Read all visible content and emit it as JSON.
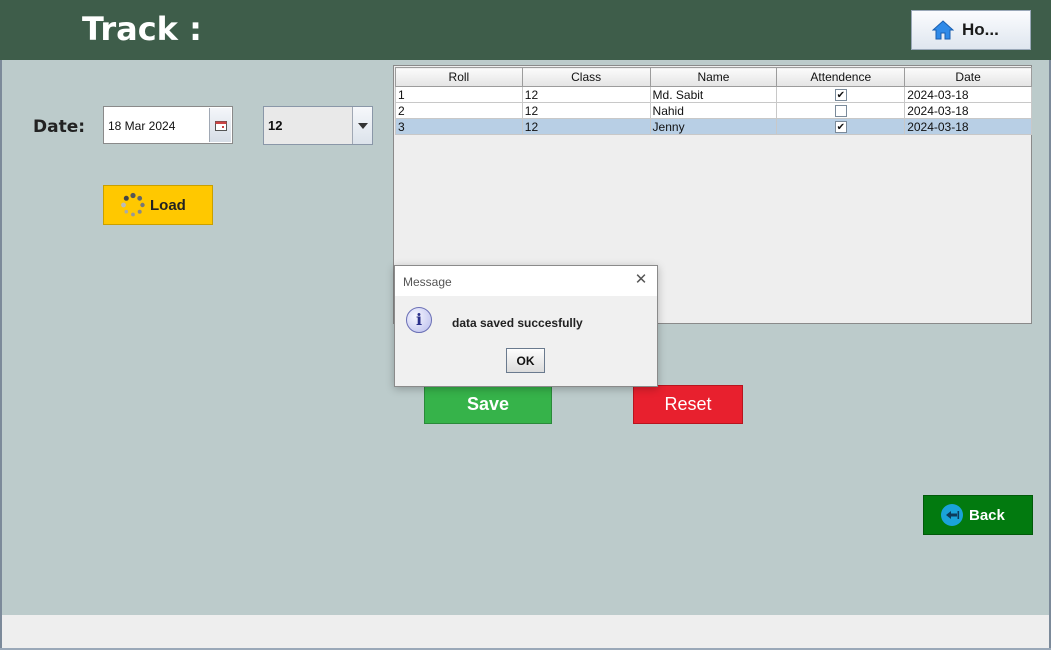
{
  "header": {
    "title": "Track :",
    "home_label": "Ho..."
  },
  "form": {
    "date_label": "Date:",
    "date_value": "18 Mar 2024",
    "class_selected": "12",
    "load_label": "Load"
  },
  "table": {
    "columns": [
      "Roll",
      "Class",
      "Name",
      "Attendence",
      "Date"
    ],
    "rows": [
      {
        "roll": "1",
        "class": "12",
        "name": "Md. Sabit",
        "attendance_mark": "✔",
        "date": "2024-03-18"
      },
      {
        "roll": "2",
        "class": "12",
        "name": "Nahid",
        "attendance_mark": "",
        "date": "2024-03-18"
      },
      {
        "roll": "3",
        "class": "12",
        "name": "Jenny",
        "attendance_mark": "✔",
        "date": "2024-03-18"
      }
    ]
  },
  "actions": {
    "save_label": "Save",
    "reset_label": "Reset",
    "back_label": "Back"
  },
  "dialog": {
    "title": "Message",
    "message": "data saved succesfully",
    "ok_label": "OK",
    "close_glyph": "✕"
  },
  "colors": {
    "header_bg": "#3e5d4a",
    "panel_bg": "#bccbcb",
    "load_bg": "#ffc800",
    "save_bg": "#36b34a",
    "reset_bg": "#e8202e",
    "back_bg": "#027a0f",
    "selected_row": "#b8cfe5"
  },
  "icons": {
    "home": "home-icon",
    "calendar": "calendar-icon",
    "dropdown": "chevron-down-icon",
    "load": "spinner-icon",
    "back": "back-arrow-icon",
    "info": "info-icon"
  }
}
